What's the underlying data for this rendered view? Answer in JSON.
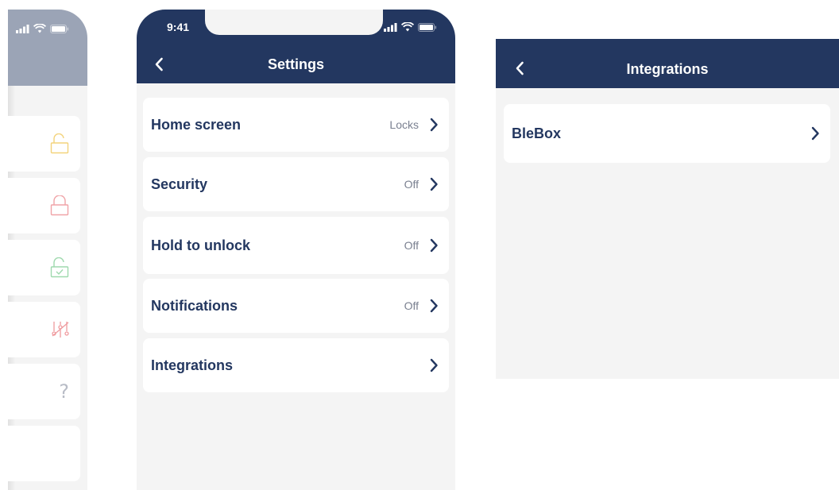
{
  "left_phone": {
    "icon_colors": {
      "unlocked": "#f3d37c",
      "locked": "#f0a4a8",
      "unlocked_check": "#9fd9ae",
      "settings": "#ef9a9e",
      "help": "#b8bcc6"
    },
    "help_glyph": "?"
  },
  "settings_screen": {
    "status_time": "9:41",
    "title": "Settings",
    "rows": [
      {
        "label": "Home screen",
        "value": "Locks"
      },
      {
        "label": "Security",
        "value": "Off"
      },
      {
        "label": "Hold to unlock",
        "value": "Off"
      },
      {
        "label": "Notifications",
        "value": "Off"
      },
      {
        "label": "Integrations",
        "value": ""
      }
    ]
  },
  "integrations_screen": {
    "title": "Integrations",
    "rows": [
      {
        "label": "BleBox"
      }
    ]
  },
  "colors": {
    "header": "#233760",
    "header_faded": "#9ba4b6",
    "background": "#f4f4f4",
    "card": "#ffffff",
    "text_primary": "#233760",
    "text_secondary": "#7a8090"
  }
}
